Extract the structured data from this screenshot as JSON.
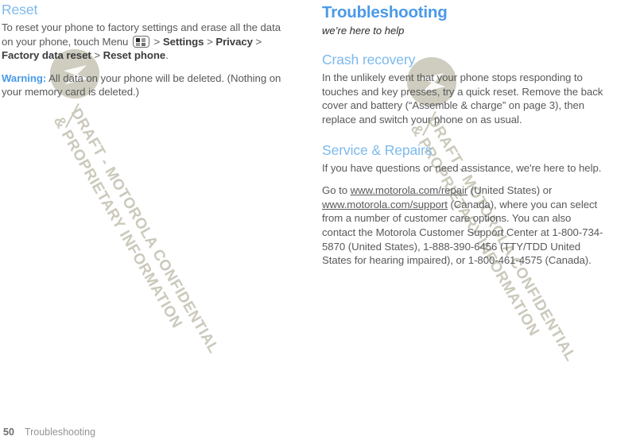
{
  "document": {
    "type": "user-guide-page-spread",
    "footer": {
      "page_number": "50",
      "chapter_label": "Troubleshooting"
    },
    "watermark": {
      "line1": "DRAFT - MOTOROLA CONFIDENTIAL",
      "line2": "& PROPRIETARY INFORMATION",
      "color": "#cbc9bb",
      "logo_icon": "motorola-m-logo-icon"
    },
    "colors": {
      "heading_chapter": "#4a9ae8",
      "heading_section": "#7cb9ec",
      "body_text": "#58595b",
      "warning_label": "#4a9ae8",
      "footer_page": "#6d6e70",
      "footer_chapter": "#939598"
    }
  },
  "left_column": {
    "section_title": "Reset",
    "paragraph_1": {
      "part_1": "To reset your phone to factory settings and erase all the data on your phone, touch Menu ",
      "menu_icon": "menu-key-icon",
      "gt_1": " > ",
      "bold_1": "Settings",
      "gt_2": " > ",
      "bold_2": "Privacy",
      "gt_3": " > ",
      "bold_3": "Factory data reset",
      "gt_4": " > ",
      "bold_4": "Reset phone",
      "part_end": "."
    },
    "paragraph_2": {
      "warning_label": "Warning:",
      "text": " All data on your phone will be deleted. (Nothing on your memory card is deleted.)"
    }
  },
  "right_column": {
    "chapter_title": "Troubleshooting",
    "chapter_subtitle": "we’re here to help",
    "sections": [
      {
        "title": "Crash recovery",
        "paragraphs": [
          "In the unlikely event that your phone stops responding to touches and key presses, try a quick reset. Remove the back cover and battery (“Assemble & charge” on page 3), then replace and switch your phone on as usual."
        ]
      },
      {
        "title": "Service & Repairs",
        "paragraphs": [
          "If you have questions or need assistance, we're here to help."
        ],
        "contact_paragraph": {
          "lead": "Go to ",
          "link_1": "www.motorola.com/repair",
          "mid_1": " (United States) or ",
          "link_2": "www.motorola.com/support",
          "mid_2": " (Canada), where you can select from a number of customer care options. You can also contact the Motorola Customer Support Center at 1-800-734-5870 (United States), 1-888-390-6456 (TTY/TDD United States for hearing impaired), or 1-800-461-4575 (Canada)."
        }
      }
    ]
  }
}
